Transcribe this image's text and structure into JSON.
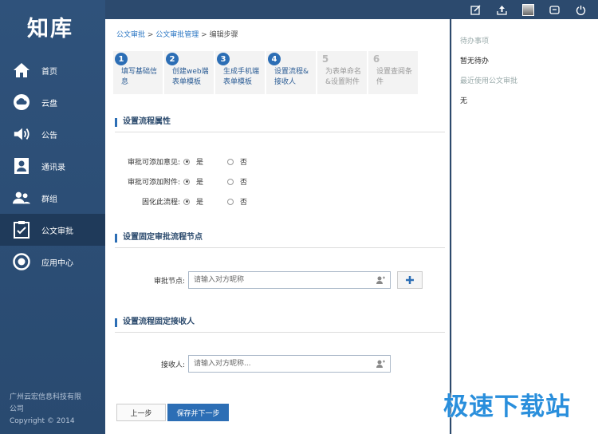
{
  "sidebar": {
    "logo": "知库",
    "items": [
      {
        "label": "首页",
        "icon": "home-icon"
      },
      {
        "label": "云盘",
        "icon": "cloud-icon"
      },
      {
        "label": "公告",
        "icon": "speaker-icon"
      },
      {
        "label": "通讯录",
        "icon": "contacts-icon"
      },
      {
        "label": "群组",
        "icon": "group-icon"
      },
      {
        "label": "公文审批",
        "icon": "approval-icon"
      },
      {
        "label": "应用中心",
        "icon": "app-center-icon"
      }
    ],
    "active_index": 5,
    "company_line1": "广州云宏信息科技有限",
    "company_line2": "公司",
    "copyright": "Copyright © 2014"
  },
  "topbar": {
    "icons": [
      "edit-icon",
      "upload-icon",
      "avatar",
      "message-icon",
      "power-icon"
    ]
  },
  "breadcrumb": {
    "item1": "公文审批",
    "sep1": " > ",
    "item2": "公文审批管理",
    "sep2": " > ",
    "current": "编辑步骤"
  },
  "steps": [
    {
      "num": "1",
      "label": "填写基础信息",
      "active": true
    },
    {
      "num": "2",
      "label": "创建web端表单模板",
      "active": true
    },
    {
      "num": "3",
      "label": "生成手机端表单模板",
      "active": true
    },
    {
      "num": "4",
      "label": "设置流程&接收人",
      "active": true
    },
    {
      "num": "5",
      "label": "为表单命名&设置附件",
      "active": false
    },
    {
      "num": "6",
      "label": "设置查阅条件",
      "active": false
    }
  ],
  "sections": {
    "process_props": "设置流程属性",
    "fixed_nodes": "设置固定审批流程节点",
    "fixed_receivers": "设置流程固定接收人"
  },
  "options": [
    {
      "label": "审批可添加意见:",
      "yes": "是",
      "no": "否",
      "selected": "yes"
    },
    {
      "label": "审批可添加附件:",
      "yes": "是",
      "no": "否",
      "selected": "yes"
    },
    {
      "label": "固化此流程:",
      "yes": "是",
      "no": "否",
      "selected": "yes"
    }
  ],
  "approval_node": {
    "label": "审批节点:",
    "placeholder": "请输入对方昵称"
  },
  "receiver": {
    "label": "接收人:",
    "placeholder": "请输入对方昵称..."
  },
  "buttons": {
    "prev": "上一步",
    "next": "保存并下一步"
  },
  "right_panel": {
    "todo_title": "待办事项",
    "todo_value": "暂无待办",
    "recent_title": "最近使用公文审批",
    "recent_value": "无"
  },
  "watermark": "极速下载站",
  "colors": {
    "sidebar": "#2f527b",
    "accent": "#2c6eb5",
    "link": "#2a76c3",
    "watermark": "#2a8fdc"
  }
}
